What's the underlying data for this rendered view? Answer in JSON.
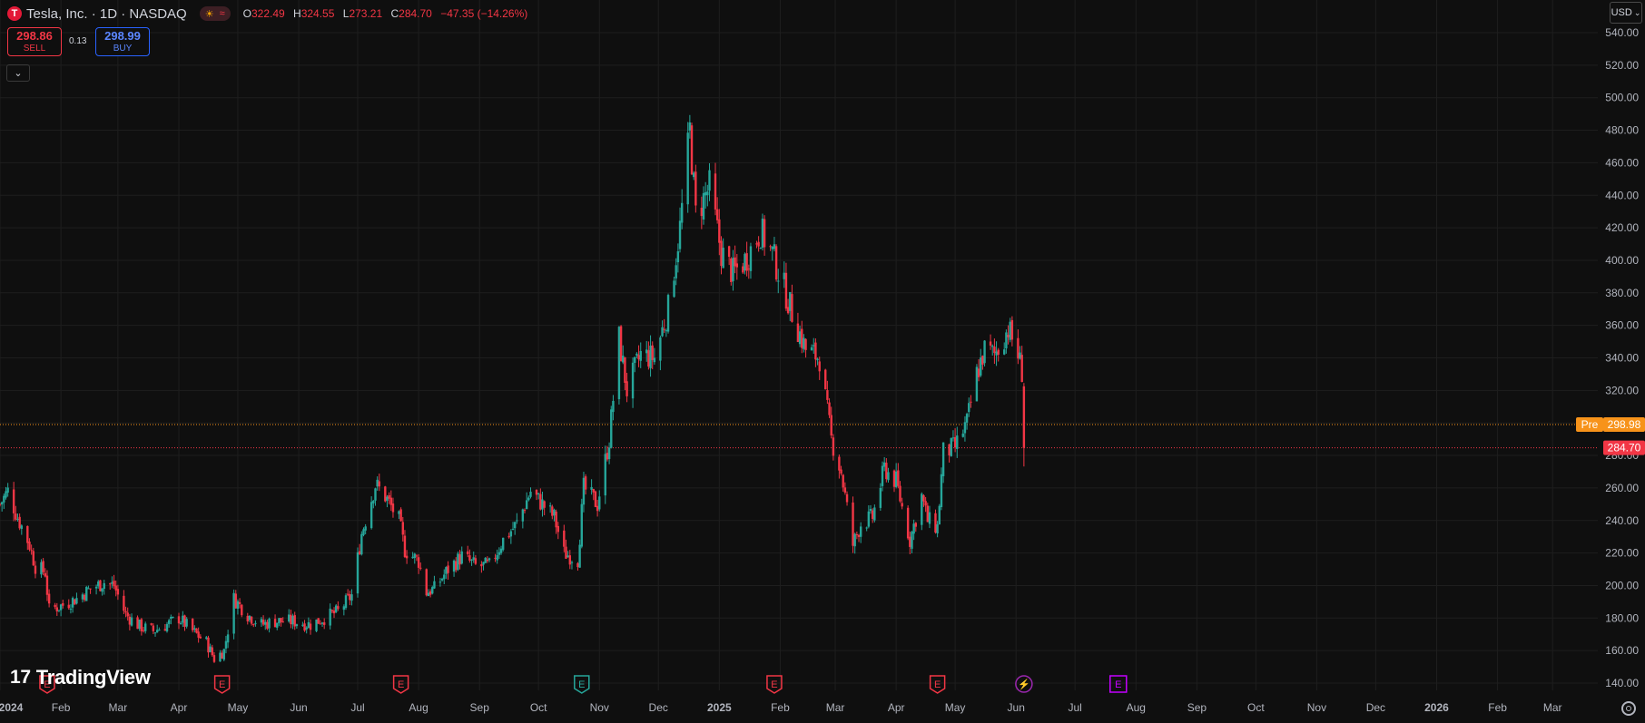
{
  "header": {
    "logo_letter": "T",
    "title": "Tesla, Inc. · 1D · NASDAQ",
    "session_icons": [
      "sun-icon",
      "wave-icon"
    ],
    "open_label": "O",
    "open": "322.49",
    "high_label": "H",
    "high": "324.55",
    "low_label": "L",
    "low": "273.21",
    "close_label": "C",
    "close": "284.70",
    "change": "−47.35 (−14.26%)"
  },
  "trade": {
    "sell_price": "298.86",
    "sell_label": "SELL",
    "spread": "0.13",
    "buy_price": "298.99",
    "buy_label": "BUY"
  },
  "currency": "USD",
  "branding": "TradingView",
  "colors": {
    "up": "#26a69a",
    "down": "#f23645",
    "pre": "#f7931a",
    "grid": "#1e1e1e"
  },
  "chart_data": {
    "type": "candlestick",
    "y_ticks": [
      "540.00",
      "520.00",
      "500.00",
      "480.00",
      "460.00",
      "440.00",
      "420.00",
      "400.00",
      "380.00",
      "360.00",
      "340.00",
      "320.00",
      "300.00",
      "280.00",
      "260.00",
      "240.00",
      "220.00",
      "200.00",
      "180.00",
      "160.00",
      "140.00"
    ],
    "ylim": [
      140,
      540
    ],
    "x_ticks": [
      {
        "label": "2024",
        "date": "2024-01-01",
        "bold": true
      },
      {
        "label": "Feb",
        "date": "2024-02-01"
      },
      {
        "label": "Mar",
        "date": "2024-03-01"
      },
      {
        "label": "Apr",
        "date": "2024-04-01"
      },
      {
        "label": "May",
        "date": "2024-05-01"
      },
      {
        "label": "Jun",
        "date": "2024-06-01"
      },
      {
        "label": "Jul",
        "date": "2024-07-01"
      },
      {
        "label": "Aug",
        "date": "2024-08-01"
      },
      {
        "label": "Sep",
        "date": "2024-09-01"
      },
      {
        "label": "Oct",
        "date": "2024-10-01"
      },
      {
        "label": "Nov",
        "date": "2024-11-01"
      },
      {
        "label": "Dec",
        "date": "2024-12-01"
      },
      {
        "label": "2025",
        "date": "2025-01-01",
        "bold": true
      },
      {
        "label": "Feb",
        "date": "2025-02-01"
      },
      {
        "label": "Mar",
        "date": "2025-03-01"
      },
      {
        "label": "Apr",
        "date": "2025-04-01"
      },
      {
        "label": "May",
        "date": "2025-05-01"
      },
      {
        "label": "Jun",
        "date": "2025-06-01"
      },
      {
        "label": "Jul",
        "date": "2025-07-01"
      },
      {
        "label": "Aug",
        "date": "2025-08-01"
      },
      {
        "label": "Sep",
        "date": "2025-09-01"
      },
      {
        "label": "Oct",
        "date": "2025-10-01"
      },
      {
        "label": "Nov",
        "date": "2025-11-01"
      },
      {
        "label": "Dec",
        "date": "2025-12-01"
      },
      {
        "label": "2026",
        "date": "2026-01-01",
        "bold": true
      },
      {
        "label": "Feb",
        "date": "2026-02-01"
      },
      {
        "label": "Mar",
        "date": "2026-03-01"
      }
    ],
    "x_range": [
      "2024-01-01",
      "2026-03-24"
    ],
    "price_lines": [
      {
        "label": "Pre",
        "value": 298.98,
        "text": "298.98",
        "color": "#f7931a"
      },
      {
        "value": 284.7,
        "text": "284.70",
        "color": "#f23645"
      }
    ],
    "events": [
      {
        "date": "2024-01-25",
        "label": "E",
        "kind": "earnings-miss"
      },
      {
        "date": "2024-04-23",
        "label": "E",
        "kind": "earnings-miss"
      },
      {
        "date": "2024-07-23",
        "label": "E",
        "kind": "earnings-miss"
      },
      {
        "date": "2024-10-23",
        "label": "E",
        "kind": "earnings-beat"
      },
      {
        "date": "2025-01-29",
        "label": "E",
        "kind": "earnings-miss"
      },
      {
        "date": "2025-04-22",
        "label": "E",
        "kind": "earnings-miss"
      },
      {
        "date": "2025-06-05",
        "label": "⚡",
        "kind": "dividend-split"
      },
      {
        "date": "2025-07-23",
        "label": "E",
        "kind": "earnings-upcoming"
      }
    ],
    "keypoints": [
      [
        "2024-01-01",
        250
      ],
      [
        "2024-01-05",
        258
      ],
      [
        "2024-01-10",
        242
      ],
      [
        "2024-01-16",
        225
      ],
      [
        "2024-01-19",
        212
      ],
      [
        "2024-01-24",
        208
      ],
      [
        "2024-01-26",
        185
      ],
      [
        "2024-02-02",
        188
      ],
      [
        "2024-02-09",
        192
      ],
      [
        "2024-02-16",
        198
      ],
      [
        "2024-02-23",
        202
      ],
      [
        "2024-02-28",
        200
      ],
      [
        "2024-03-05",
        182
      ],
      [
        "2024-03-12",
        175
      ],
      [
        "2024-03-19",
        172
      ],
      [
        "2024-03-26",
        176
      ],
      [
        "2024-04-01",
        180
      ],
      [
        "2024-04-08",
        172
      ],
      [
        "2024-04-15",
        165
      ],
      [
        "2024-04-19",
        155
      ],
      [
        "2024-04-24",
        160
      ],
      [
        "2024-04-29",
        192
      ],
      [
        "2024-05-06",
        182
      ],
      [
        "2024-05-13",
        176
      ],
      [
        "2024-05-20",
        178
      ],
      [
        "2024-05-29",
        178
      ],
      [
        "2024-06-07",
        176
      ],
      [
        "2024-06-14",
        180
      ],
      [
        "2024-06-21",
        184
      ],
      [
        "2024-06-28",
        194
      ],
      [
        "2024-07-03",
        232
      ],
      [
        "2024-07-10",
        262
      ],
      [
        "2024-07-15",
        255
      ],
      [
        "2024-07-22",
        240
      ],
      [
        "2024-07-25",
        222
      ],
      [
        "2024-08-01",
        215
      ],
      [
        "2024-08-05",
        196
      ],
      [
        "2024-08-09",
        198
      ],
      [
        "2024-08-16",
        210
      ],
      [
        "2024-08-23",
        218
      ],
      [
        "2024-08-30",
        212
      ],
      [
        "2024-09-06",
        212
      ],
      [
        "2024-09-13",
        228
      ],
      [
        "2024-09-20",
        238
      ],
      [
        "2024-09-27",
        258
      ],
      [
        "2024-10-03",
        250
      ],
      [
        "2024-10-09",
        242
      ],
      [
        "2024-10-14",
        220
      ],
      [
        "2024-10-21",
        216
      ],
      [
        "2024-10-24",
        260
      ],
      [
        "2024-10-31",
        250
      ],
      [
        "2024-11-06",
        290
      ],
      [
        "2024-11-11",
        352
      ],
      [
        "2024-11-15",
        320
      ],
      [
        "2024-11-22",
        342
      ],
      [
        "2024-11-29",
        340
      ],
      [
        "2024-12-06",
        370
      ],
      [
        "2024-12-12",
        420
      ],
      [
        "2024-12-17,",
        480
      ],
      [
        "2024-12-20",
        428
      ],
      [
        "2024-12-27",
        445
      ],
      [
        "2025-01-02",
        405
      ],
      [
        "2025-01-08",
        392
      ],
      [
        "2025-01-14",
        400
      ],
      [
        "2025-01-22",
        418
      ],
      [
        "2025-01-28",
        404
      ],
      [
        "2025-02-03",
        383
      ],
      [
        "2025-02-07",
        368
      ],
      [
        "2025-02-14",
        345
      ],
      [
        "2025-02-21",
        340
      ],
      [
        "2025-02-27",
        290
      ],
      [
        "2025-03-04",
        270
      ],
      [
        "2025-03-10",
        225
      ],
      [
        "2025-03-14",
        238
      ],
      [
        "2025-03-20",
        242
      ],
      [
        "2025-03-26",
        272
      ],
      [
        "2025-04-01",
        264
      ],
      [
        "2025-04-04",
        248
      ],
      [
        "2025-04-08",
        228
      ],
      [
        "2025-04-14",
        255
      ],
      [
        "2025-04-17",
        240
      ],
      [
        "2025-04-22",
        236
      ],
      [
        "2025-04-25",
        282
      ],
      [
        "2025-05-01",
        285
      ],
      [
        "2025-05-07",
        300
      ],
      [
        "2025-05-12",
        330
      ],
      [
        "2025-05-16",
        345
      ],
      [
        "2025-05-21",
        342
      ],
      [
        "2025-05-28",
        358
      ],
      [
        "2025-06-02",
        342
      ],
      [
        "2025-06-04",
        332
      ],
      [
        "2025-06-05",
        284.7
      ]
    ],
    "current": {
      "open": 322.49,
      "high": 324.55,
      "low": 273.21,
      "close": 284.7
    }
  }
}
